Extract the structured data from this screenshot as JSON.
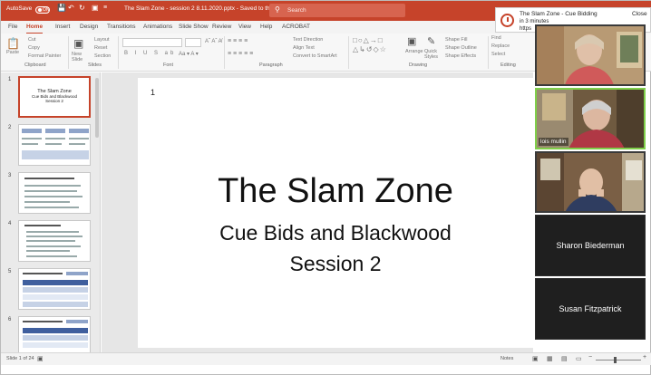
{
  "titlebar": {
    "autosave_label": "AutoSave",
    "autosave_state": "ON",
    "file_title": "The Slam Zone - session 2 8.11.2020.pptx - Saved to this PC",
    "search_placeholder": "Search"
  },
  "tabs": [
    "File",
    "Home",
    "Insert",
    "Design",
    "Transitions",
    "Animations",
    "Slide Show",
    "Review",
    "View",
    "Help",
    "ACROBAT"
  ],
  "ribbon": {
    "paste": "Paste",
    "cut": "Cut",
    "copy": "Copy",
    "format_painter": "Format Painter",
    "new_slide": "New Slide",
    "layout": "Layout",
    "reset": "Reset",
    "section": "Section",
    "text_direction": "Text Direction",
    "align_text": "Align Text",
    "convert_smartart": "Convert to SmartArt",
    "arrange": "Arrange",
    "quick_styles": "Quick Styles",
    "shape_fill": "Shape Fill",
    "shape_outline": "Shape Outline",
    "shape_effects": "Shape Effects",
    "find": "Find",
    "replace": "Replace",
    "select": "Select",
    "groups": [
      "Clipboard",
      "Slides",
      "Font",
      "Paragraph",
      "Drawing",
      "Editing"
    ]
  },
  "thumbs": {
    "numbers": [
      "1",
      "2",
      "3",
      "4",
      "5",
      "6"
    ],
    "slide1_title": "The Slam Zone",
    "slide1_sub": "Cue Bids and Blackwood",
    "slide1_session": "Session 2"
  },
  "slide": {
    "number": "1",
    "title": "The Slam Zone",
    "subtitle1": "Cue Bids and Blackwood",
    "subtitle2": "Session 2"
  },
  "status": {
    "slide_count": "Slide 1 of 24",
    "notes": "Notes"
  },
  "notification": {
    "title": "The Slam Zone - Cue Bidding",
    "time": "in 3 minutes",
    "link": "https",
    "close": "Close"
  },
  "participants": {
    "lois": "lois mullin",
    "sharon": "Sharon Biederman",
    "susan": "Susan Fitzpatrick"
  },
  "colors": {
    "accent": "#c6432a",
    "active_speaker": "#7fcf4a",
    "tile_bg": "#1f1f1f"
  }
}
